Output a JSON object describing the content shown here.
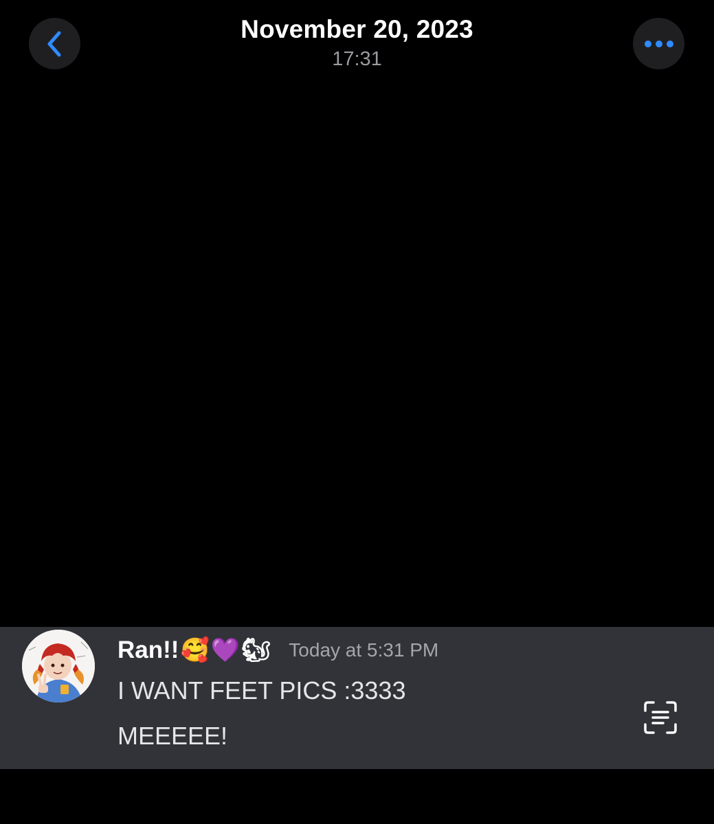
{
  "header": {
    "date": "November 20, 2023",
    "time": "17:31",
    "back_icon": "chevron-left-icon",
    "more_icon": "ellipsis-icon",
    "accent_color": "#2f8cff"
  },
  "message": {
    "username": "Ran!!",
    "username_badges": [
      "🥰",
      "💜",
      "🐿"
    ],
    "timestamp": "Today at 5:31 PM",
    "lines": [
      "I WANT FEET PICS :3333",
      "MEEEEE!"
    ],
    "avatar_icon": "user-avatar",
    "action_icon": "text-scan-icon",
    "bar_color": "#323338"
  }
}
